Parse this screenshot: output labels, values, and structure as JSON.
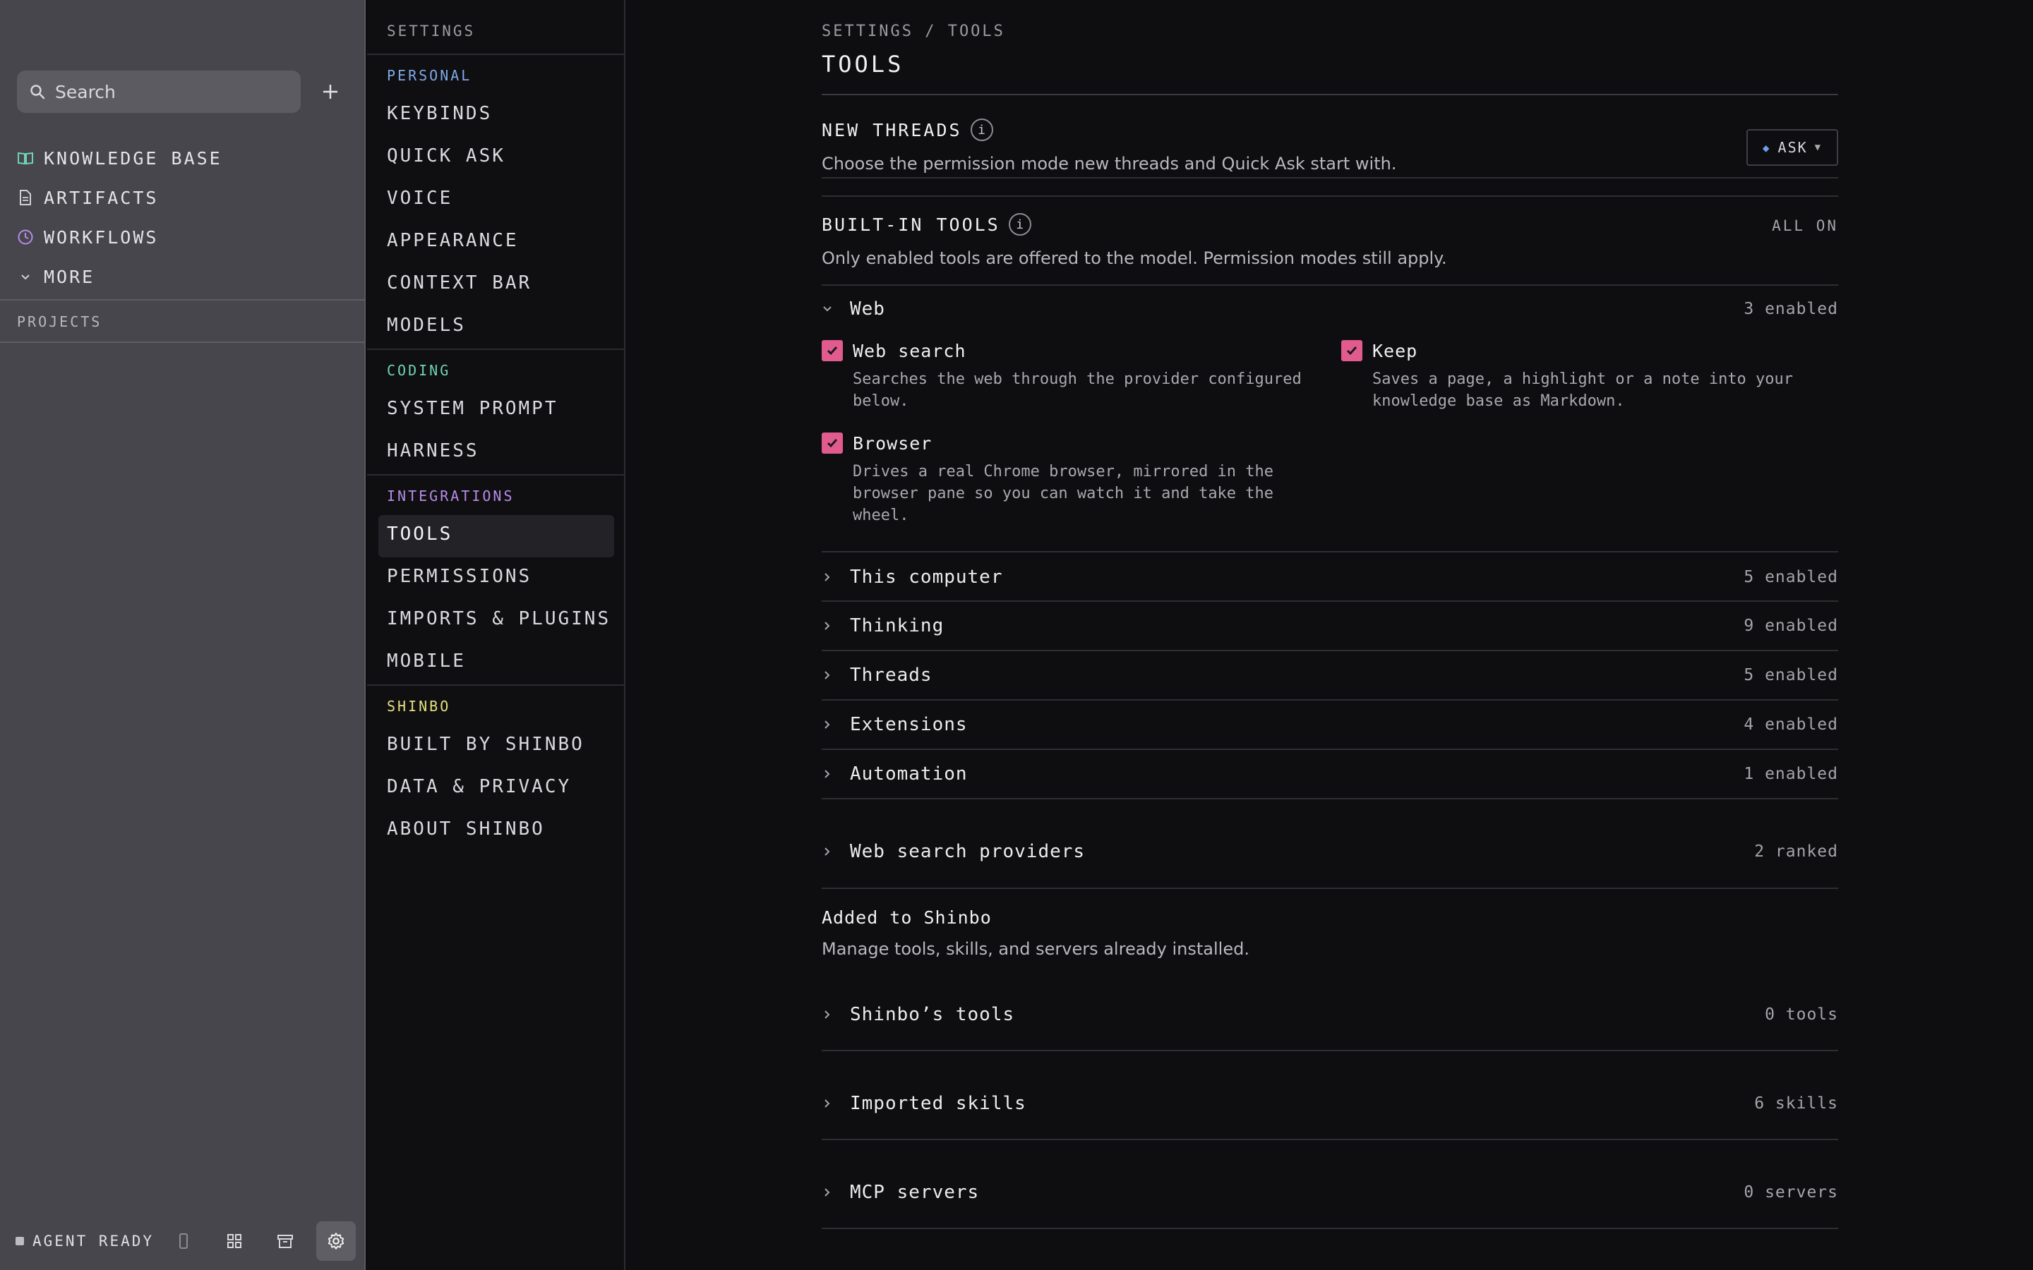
{
  "colors": {
    "accent_pink": "#e25b8e",
    "personal": "#7fa9e6",
    "coding": "#6fd4b4",
    "integrations": "#b88be6",
    "shinbo": "#e6e07a"
  },
  "sidebar": {
    "search_placeholder": "Search",
    "items": [
      {
        "label": "KNOWLEDGE BASE",
        "icon": "book-icon"
      },
      {
        "label": "ARTIFACTS",
        "icon": "document-icon"
      },
      {
        "label": "WORKFLOWS",
        "icon": "clock-icon"
      },
      {
        "label": "MORE",
        "icon": "chevron-down-icon"
      }
    ],
    "projects_label": "PROJECTS",
    "status": "AGENT READY"
  },
  "settings_nav": {
    "title": "SETTINGS",
    "groups": [
      {
        "label": "PERSONAL",
        "items": [
          "KEYBINDS",
          "QUICK ASK",
          "VOICE",
          "APPEARANCE",
          "CONTEXT BAR",
          "MODELS"
        ]
      },
      {
        "label": "CODING",
        "items": [
          "SYSTEM PROMPT",
          "HARNESS"
        ]
      },
      {
        "label": "INTEGRATIONS",
        "items": [
          "TOOLS",
          "PERMISSIONS",
          "IMPORTS & PLUGINS",
          "MOBILE"
        ]
      },
      {
        "label": "SHINBO",
        "items": [
          "BUILT BY SHINBO",
          "DATA & PRIVACY",
          "ABOUT SHINBO"
        ]
      }
    ],
    "active": "TOOLS"
  },
  "main": {
    "breadcrumb": "SETTINGS / TOOLS",
    "title": "TOOLS",
    "new_threads": {
      "title": "NEW THREADS",
      "description": "Choose the permission mode new threads and Quick Ask start with.",
      "mode": "ASK"
    },
    "builtin": {
      "title": "BUILT-IN TOOLS",
      "status": "ALL ON",
      "description": "Only enabled tools are offered to the model. Permission modes still apply.",
      "web": {
        "name": "Web",
        "count": "3 enabled",
        "tools": [
          {
            "name": "Web search",
            "desc": "Searches the web through the provider configured below."
          },
          {
            "name": "Keep",
            "desc": "Saves a page, a highlight or a note into your knowledge base as Markdown."
          },
          {
            "name": "Browser",
            "desc": "Drives a real Chrome browser, mirrored in the browser pane so you can watch it and take the wheel."
          }
        ]
      },
      "groups": [
        {
          "name": "This computer",
          "count": "5 enabled"
        },
        {
          "name": "Thinking",
          "count": "9 enabled"
        },
        {
          "name": "Threads",
          "count": "5 enabled"
        },
        {
          "name": "Extensions",
          "count": "4 enabled"
        },
        {
          "name": "Automation",
          "count": "1 enabled"
        }
      ]
    },
    "providers": {
      "name": "Web search providers",
      "count": "2 ranked"
    },
    "added": {
      "title": "Added to Shinbo",
      "description": "Manage tools, skills, and servers already installed.",
      "items": [
        {
          "name": "Shinbo’s tools",
          "count": "0 tools"
        },
        {
          "name": "Imported skills",
          "count": "6 skills"
        },
        {
          "name": "MCP servers",
          "count": "0 servers"
        }
      ]
    }
  }
}
